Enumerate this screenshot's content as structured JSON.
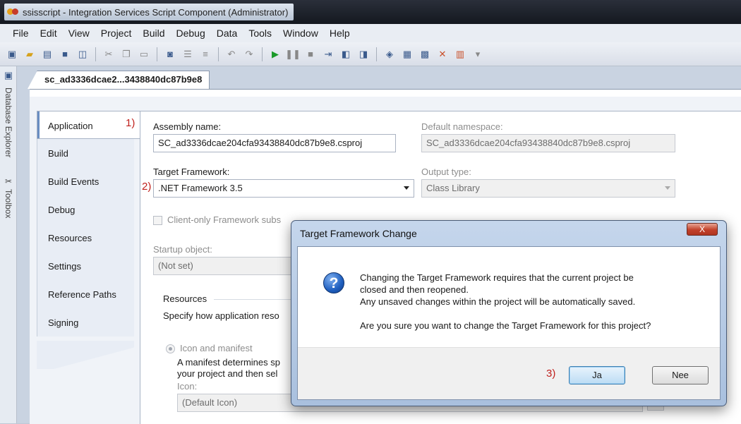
{
  "window": {
    "title": "ssisscript - Integration Services Script Component (Administrator)"
  },
  "menu": [
    "File",
    "Edit",
    "View",
    "Project",
    "Build",
    "Debug",
    "Data",
    "Tools",
    "Window",
    "Help"
  ],
  "toolbar": {
    "icons": [
      "add-item-icon",
      "open-icon",
      "new-icon",
      "save-icon",
      "save-all-icon",
      "cut-icon",
      "copy-icon",
      "paste-icon",
      "find-icon",
      "comment-icon",
      "uncomment-icon",
      "undo-icon",
      "redo-icon",
      "start-icon",
      "pause-icon",
      "stop-icon",
      "step-icon",
      "breakpoint-icon",
      "bookmark-icon",
      "solution-explorer-icon",
      "properties-icon",
      "object-browser-icon",
      "toolbox-icon",
      "extensions-icon",
      "overflow-icon"
    ]
  },
  "side_panels": {
    "database_explorer": "Database Explorer",
    "toolbox": "Toolbox"
  },
  "document": {
    "tab_title": "sc_ad3336dcae2...3438840dc87b9e8"
  },
  "project_tabs": [
    "Application",
    "Build",
    "Build Events",
    "Debug",
    "Resources",
    "Settings",
    "Reference Paths",
    "Signing"
  ],
  "callouts": {
    "one": "1)",
    "two": "2)",
    "three": "3)"
  },
  "application": {
    "assembly_label": "Assembly name:",
    "assembly_value": "SC_ad3336dcae204cfa93438840dc87b9e8.csproj",
    "namespace_label": "Default namespace:",
    "namespace_value": "SC_ad3336dcae204cfa93438840dc87b9e8.csproj",
    "target_label": "Target Framework:",
    "target_value": ".NET Framework 3.5",
    "output_label": "Output type:",
    "output_value": "Class Library",
    "client_only_label": "Client-only Framework subs",
    "startup_label": "Startup object:",
    "startup_value": "(Not set)",
    "resources_heading": "Resources",
    "resources_desc": "Specify how application reso",
    "icon_manifest_label": "Icon and manifest",
    "manifest_line1": "A manifest determines sp",
    "manifest_line2": "your project and then sel",
    "icon_label": "Icon:",
    "icon_value": "(Default Icon)",
    "browse_label": "..."
  },
  "dialog": {
    "title": "Target Framework Change",
    "close_label": "X",
    "line1": "Changing the Target Framework requires that the current project be",
    "line2": "closed and then reopened.",
    "line3": "Any unsaved changes within the project will be automatically saved.",
    "question": "Are you sure you want to change the Target Framework for this project?",
    "yes_label": "Ja",
    "no_label": "Nee"
  }
}
